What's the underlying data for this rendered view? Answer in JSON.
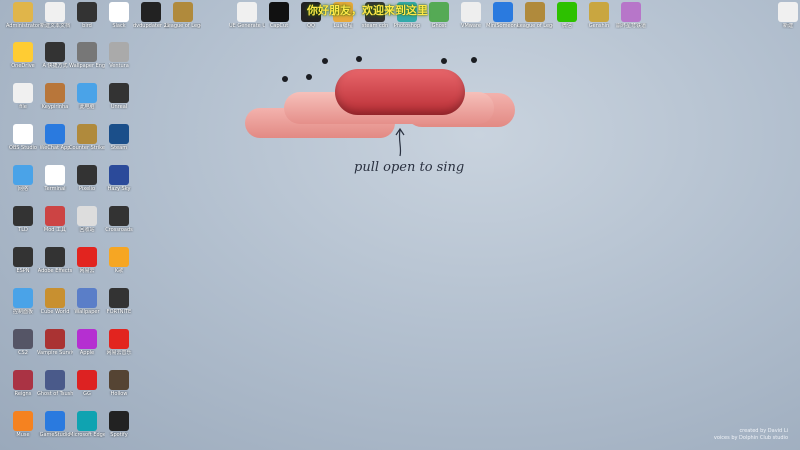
{
  "banner": "你好朋友，欢迎来到这里",
  "caption": "pull open to sing",
  "credits": {
    "line1": "created by David Li",
    "line2": "voices by Dolphin Club studio"
  },
  "colors": {
    "hotdog": "#e98a84",
    "sausage": "#d9444a",
    "wallpaper": "#b3c0cf"
  },
  "desktop_icons": [
    {
      "label": "Administrator",
      "icon": "folder-icon",
      "color": "#e0b54a"
    },
    {
      "label": "新建文本文档",
      "icon": "file-icon",
      "color": "#f0f0f0"
    },
    {
      "label": "bird",
      "icon": "app-icon",
      "color": "#333"
    },
    {
      "label": "Slack",
      "icon": "app-icon",
      "color": "#fff"
    },
    {
      "label": "dvdupdater 2022",
      "icon": "app-icon",
      "color": "#222"
    },
    {
      "label": "League of Legends",
      "icon": "game-icon",
      "color": "#b08a3c"
    },
    {
      "label": "UE Generate Unreal",
      "icon": "file-icon",
      "color": "#f0f0f0"
    },
    {
      "label": "CapCut",
      "icon": "app-icon",
      "color": "#111"
    },
    {
      "label": "QQ",
      "icon": "qq-icon",
      "color": "#222"
    },
    {
      "label": "Lua编程",
      "icon": "app-icon",
      "color": "#e7a93b"
    },
    {
      "label": "steam cdn",
      "icon": "app-icon",
      "color": "#333"
    },
    {
      "label": "Photoshop",
      "icon": "app-icon",
      "color": "#3aa"
    },
    {
      "label": "Ghost",
      "icon": "app-icon",
      "color": "#5a5"
    },
    {
      "label": "VMware",
      "icon": "app-icon",
      "color": "#eee"
    },
    {
      "label": "MiniSomeone",
      "icon": "app-icon",
      "color": "#2a7adf"
    },
    {
      "label": "League of Legends",
      "icon": "game-icon",
      "color": "#b08a3c"
    },
    {
      "label": "微信",
      "icon": "wechat-icon",
      "color": "#2dc100"
    },
    {
      "label": "Genshin",
      "icon": "game-icon",
      "color": "#c9a640"
    },
    {
      "label": "崩坏星穹铁道",
      "icon": "game-icon",
      "color": "#b776c9"
    },
    {
      "label": "新建",
      "icon": "file-icon",
      "color": "#f0f0f0"
    },
    {
      "label": "OneDrive",
      "icon": "app-icon",
      "color": "#ffcc33"
    },
    {
      "label": "A 快捷方式",
      "icon": "app-icon",
      "color": "#333"
    },
    {
      "label": "Wallpaper Engine",
      "icon": "app-icon",
      "color": "#777"
    },
    {
      "label": "Ventura",
      "icon": "app-icon",
      "color": "#aaa"
    },
    {
      "label": "file",
      "icon": "file-icon",
      "color": "#f0f0f0"
    },
    {
      "label": "Keypirinha",
      "icon": "app-icon",
      "color": "#b8763a"
    },
    {
      "label": "此电脑",
      "icon": "computer-icon",
      "color": "#4aa3e8"
    },
    {
      "label": "Unreal",
      "icon": "app-icon",
      "color": "#333"
    },
    {
      "label": "OBS Studio",
      "icon": "app-icon",
      "color": "#fff"
    },
    {
      "label": "WeChat App",
      "icon": "app-icon",
      "color": "#2a7adf"
    },
    {
      "label": "Counter Strike",
      "icon": "game-icon",
      "color": "#b08a3c"
    },
    {
      "label": "Steam",
      "icon": "steam-icon",
      "color": "#1b4f8a"
    },
    {
      "label": "网络",
      "icon": "network-icon",
      "color": "#4aa3e8"
    },
    {
      "label": "Terminal",
      "icon": "app-icon",
      "color": "#fff"
    },
    {
      "label": "Pixelio",
      "icon": "app-icon",
      "color": "#333"
    },
    {
      "label": "Hazy Sky",
      "icon": "app-icon",
      "color": "#2b4a9a"
    },
    {
      "label": "TLD",
      "icon": "app-icon",
      "color": "#333"
    },
    {
      "label": "Mod 工具",
      "icon": "app-icon",
      "color": "#c44"
    },
    {
      "label": "回收站",
      "icon": "recycle-bin-icon",
      "color": "#ddd"
    },
    {
      "label": "Crossroads",
      "icon": "app-icon",
      "color": "#333"
    },
    {
      "label": "ESPN",
      "icon": "app-icon",
      "color": "#333"
    },
    {
      "label": "Adobe Effects",
      "icon": "app-icon",
      "color": "#333"
    },
    {
      "label": "网易云",
      "icon": "app-icon",
      "color": "#e2241f"
    },
    {
      "label": "K歌",
      "icon": "app-icon",
      "color": "#f6a623"
    },
    {
      "label": "控制面板",
      "icon": "control-panel-icon",
      "color": "#4aa3e8"
    },
    {
      "label": "Cube World",
      "icon": "game-icon",
      "color": "#c89030"
    },
    {
      "label": "Wallpaper",
      "icon": "app-icon",
      "color": "#5a7ec8"
    },
    {
      "label": "FORTNITE",
      "icon": "game-icon",
      "color": "#333"
    },
    {
      "label": "CS2",
      "icon": "game-icon",
      "color": "#556"
    },
    {
      "label": "Vampire Survivors",
      "icon": "game-icon",
      "color": "#a33"
    },
    {
      "label": "Apple",
      "icon": "app-icon",
      "color": "#b52fd1"
    },
    {
      "label": "网易云音乐",
      "icon": "app-icon",
      "color": "#e2241f"
    },
    {
      "label": "Reigns",
      "icon": "game-icon",
      "color": "#a34"
    },
    {
      "label": "Ghost of Tsushima",
      "icon": "game-icon",
      "color": "#4a5a8a"
    },
    {
      "label": "GG",
      "icon": "app-icon",
      "color": "#d22"
    },
    {
      "label": "Hollow",
      "icon": "game-icon",
      "color": "#543"
    },
    {
      "label": "Muse",
      "icon": "app-icon",
      "color": "#f58220"
    },
    {
      "label": "GameStudio",
      "icon": "app-icon",
      "color": "#2a7adf"
    },
    {
      "label": "Microsoft Edge",
      "icon": "edge-icon",
      "color": "#0fa3b1"
    },
    {
      "label": "Spotify",
      "icon": "app-icon",
      "color": "#222"
    },
    {
      "label": "Google Photos",
      "icon": "app-icon",
      "color": "#777"
    },
    {
      "label": "Settings",
      "icon": "gear-icon",
      "color": "#2a7adf"
    },
    {
      "label": "Guardian",
      "icon": "app-icon",
      "color": "#333"
    },
    {
      "label": "Bully",
      "icon": "game-icon",
      "color": "#554"
    },
    {
      "label": "Crossing",
      "icon": "app-icon",
      "color": "#222"
    },
    {
      "label": "Origin",
      "icon": "app-icon",
      "color": "#f06"
    },
    {
      "label": "Warframe",
      "icon": "game-icon",
      "color": "#322"
    },
    {
      "label": "Roblox",
      "icon": "game-icon",
      "color": "#c22"
    },
    {
      "label": "Messenger",
      "icon": "app-icon",
      "color": "#a66"
    },
    {
      "label": "Epic Games",
      "icon": "epic-icon",
      "color": "#222"
    },
    {
      "label": "文件",
      "icon": "file-icon",
      "color": "#f0f0f0"
    }
  ]
}
